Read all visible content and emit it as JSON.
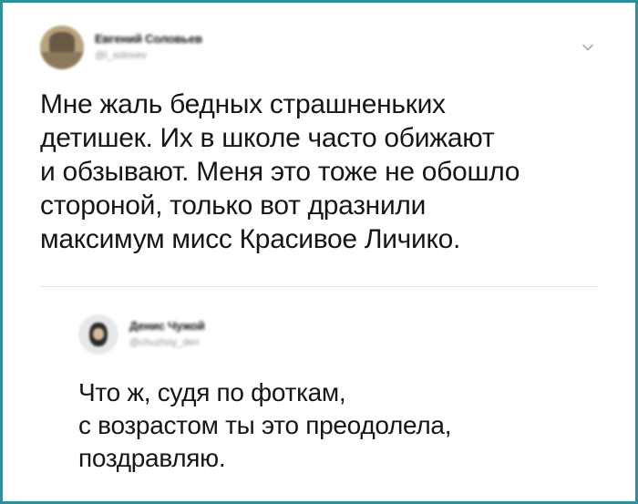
{
  "tweet": {
    "author_name": "Евгений Соловьев",
    "author_handle": "@l_solovev",
    "text": "Мне жаль бедных страшненьких\nдетишек. Их в школе часто обижают\nи обзывают. Меня это тоже не обошло\nстороной, только вот дразнили\nмаксимум мисс Красивое Личико."
  },
  "reply": {
    "author_name": "Денис Чужой",
    "author_handle": "@chuzhoy_den",
    "text": "Что ж, судя по фоткам,\nс возрастом ты это преодолела,\nпоздравляю."
  },
  "icons": {
    "menu": "chevron-down-icon"
  },
  "colors": {
    "frame_border": "#2f8f9d",
    "text": "#14171a",
    "secondary_text": "#8a8f94",
    "divider": "#e1e8ed"
  }
}
